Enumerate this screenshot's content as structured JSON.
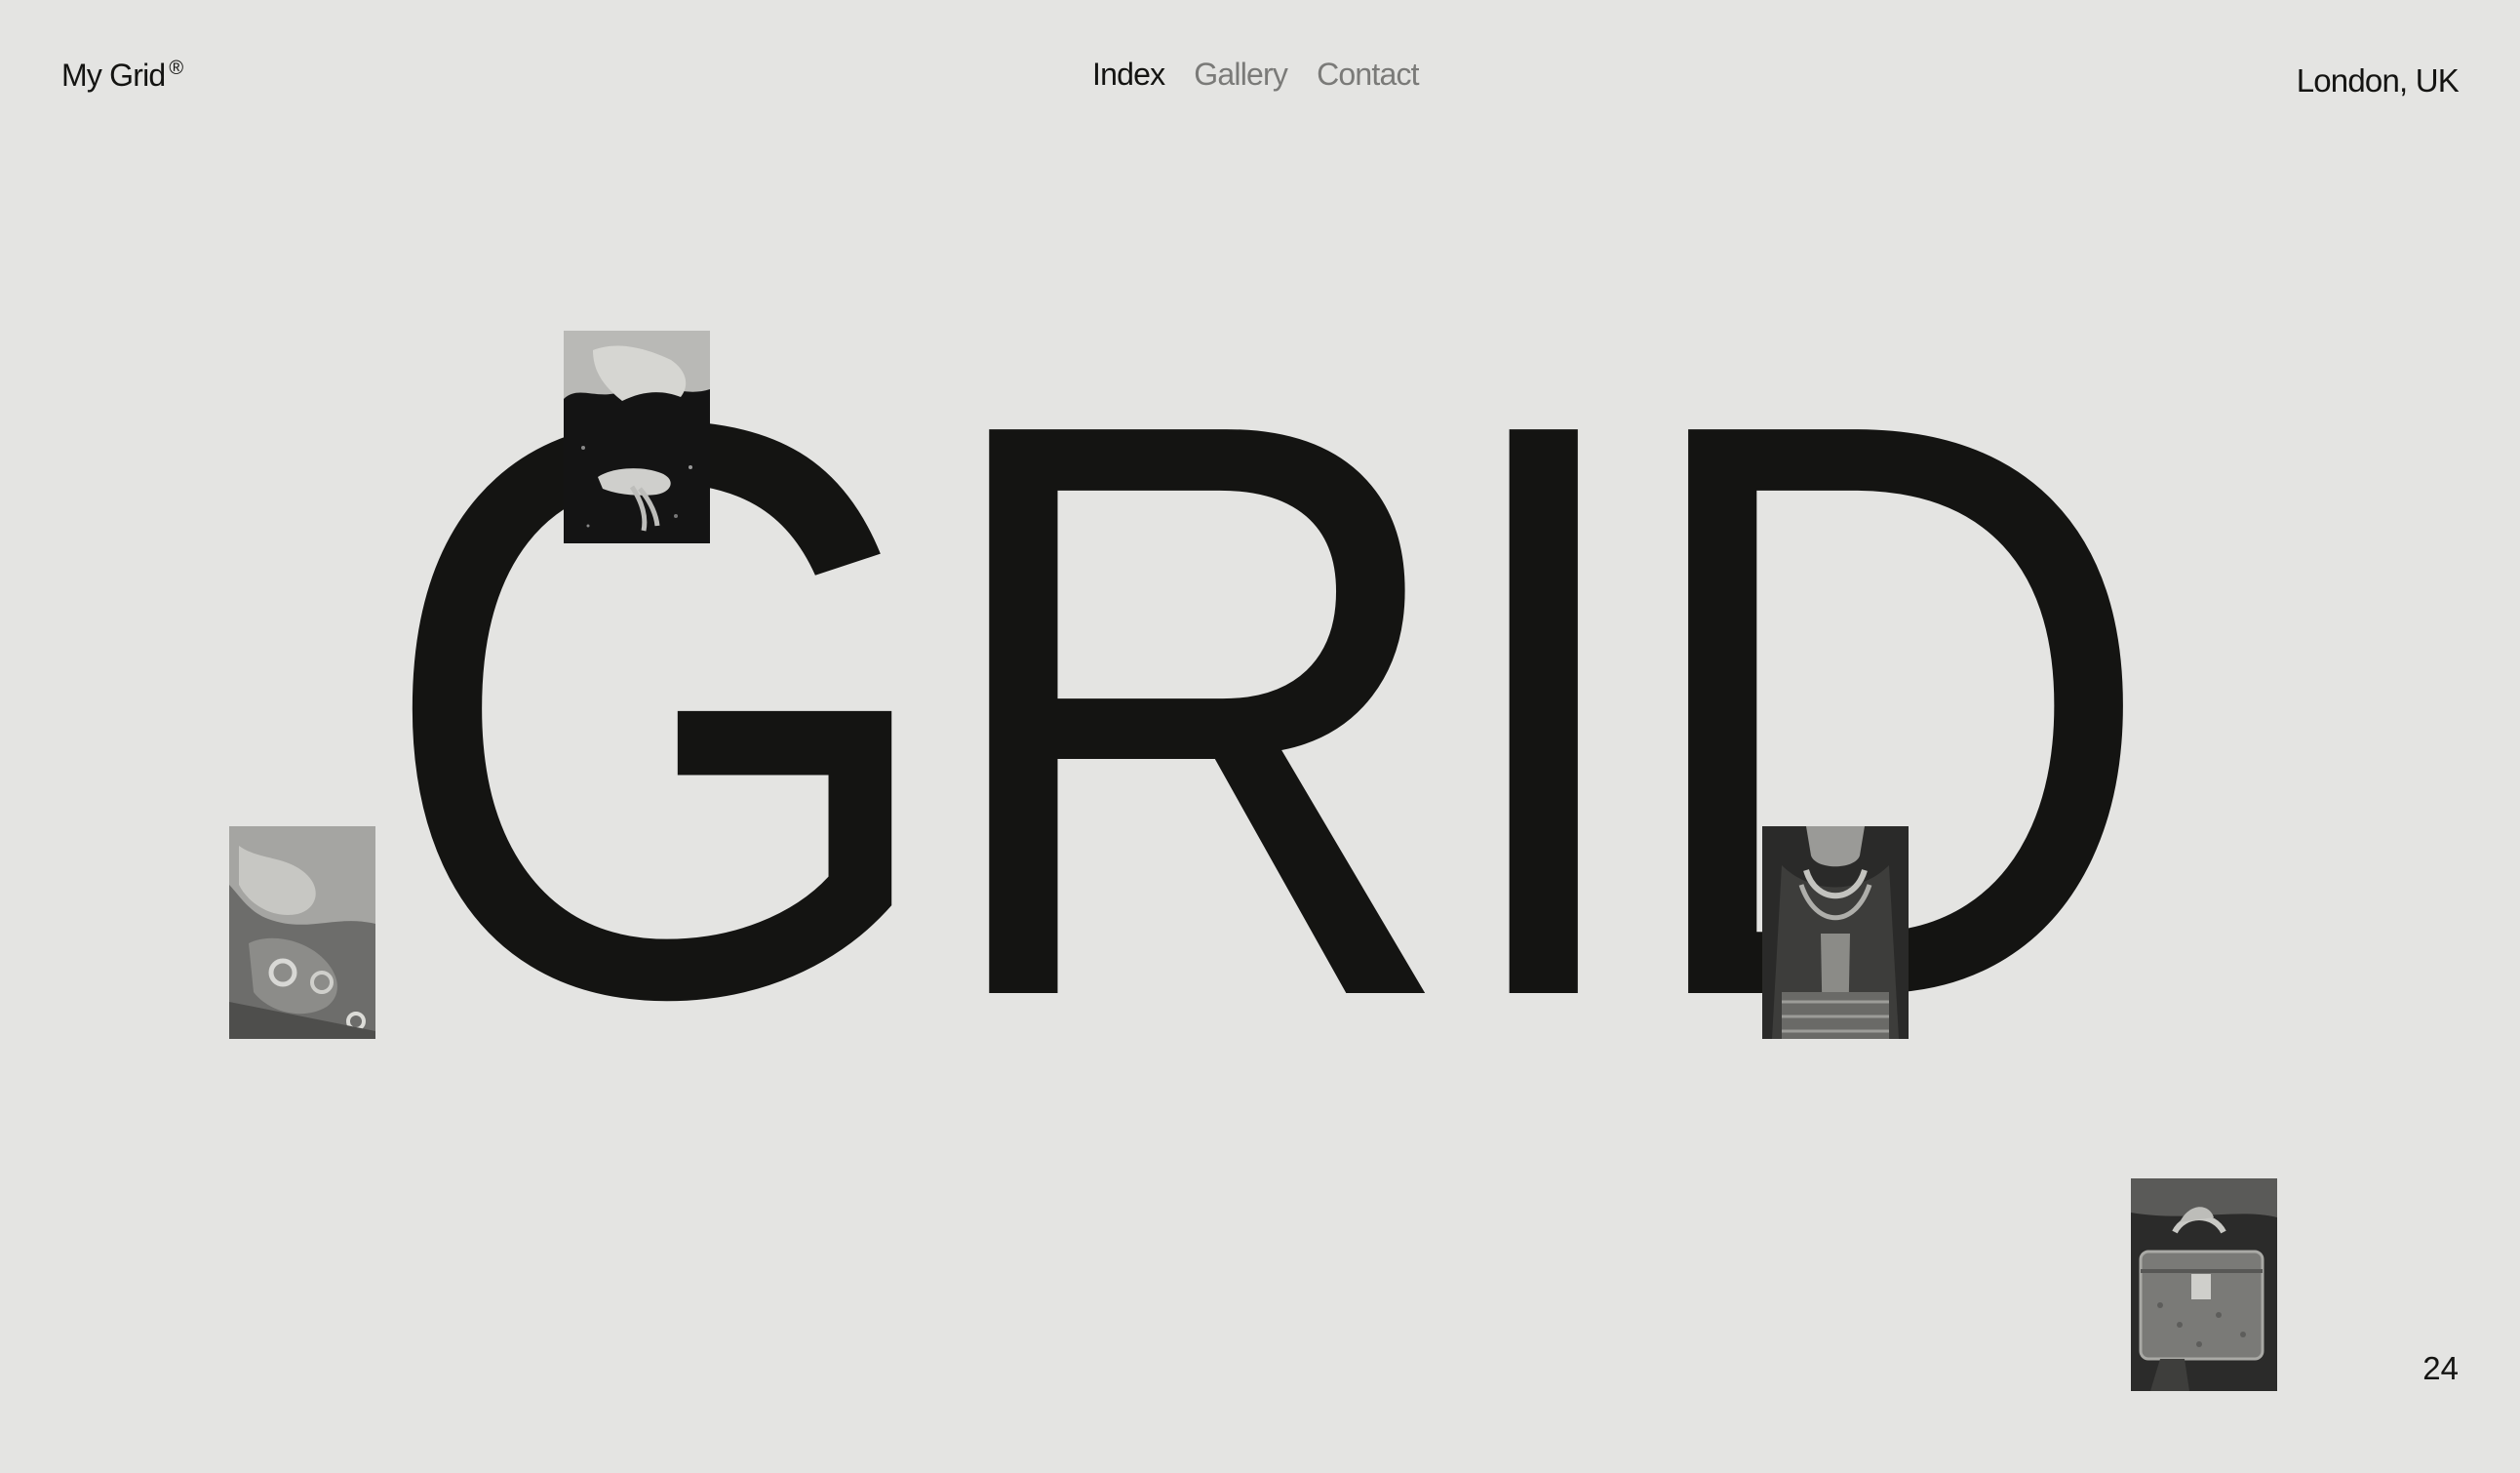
{
  "header": {
    "logo_text": "My Grid",
    "logo_mark": "®",
    "nav": [
      {
        "label": "Index",
        "active": true
      },
      {
        "label": "Gallery",
        "active": false
      },
      {
        "label": "Contact",
        "active": false
      }
    ],
    "location": "London, UK"
  },
  "hero": {
    "word": "GRID"
  },
  "footer": {
    "counter": "24"
  },
  "colors": {
    "background": "#e4e4e2",
    "text": "#141412",
    "nav_inactive": "#7a7a78"
  }
}
